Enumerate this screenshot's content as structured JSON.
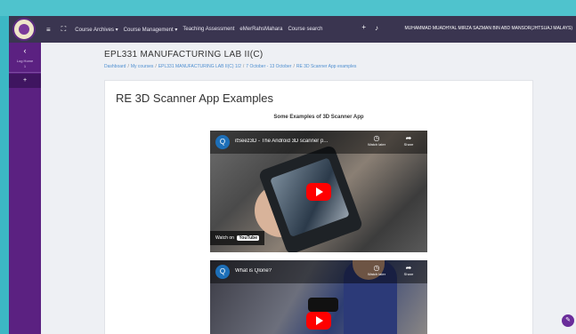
{
  "topbar": {
    "menu": [
      "Course Archives ▾",
      "Course Management ▾",
      "Teaching Assessment",
      "eMerRahsMahara",
      "Course search"
    ],
    "user_name": "MUHAMMAD MUADHYAL MIRZA SAZMAN BIN ABD MANSOR(JHTSUAJ MALAYS)"
  },
  "sidebar": {
    "back_label": "‹",
    "label": "Log Home",
    "sub_label": "1",
    "active_item": "+"
  },
  "page": {
    "course_title": "EPL331 MANUFACTURING LAB II(C)",
    "breadcrumb": [
      "Dashboard",
      "My courses",
      "EPL331 MANUFACTURING LAB II(C) 1/2",
      "7 October - 13 October",
      "RE 3D Scanner App examples"
    ]
  },
  "content": {
    "title": "RE 3D Scanner App Examples",
    "subtitle": "Some Examples of 3D Scanner App",
    "videos": [
      {
        "channel_initial": "Q",
        "title": "itSeez3D - The Android 3D scanner p...",
        "watch_later": "Watch later",
        "share": "Share",
        "watch_on": "Watch on",
        "youtube": "YouTube"
      },
      {
        "channel_initial": "Q",
        "title": "What is Qlone?",
        "watch_later": "Watch later",
        "share": "Share"
      }
    ]
  },
  "colors": {
    "sidebar": "#5b2181",
    "topbar": "#3a3550",
    "link": "#4f8fd0",
    "youtube_red": "#ff0000"
  }
}
